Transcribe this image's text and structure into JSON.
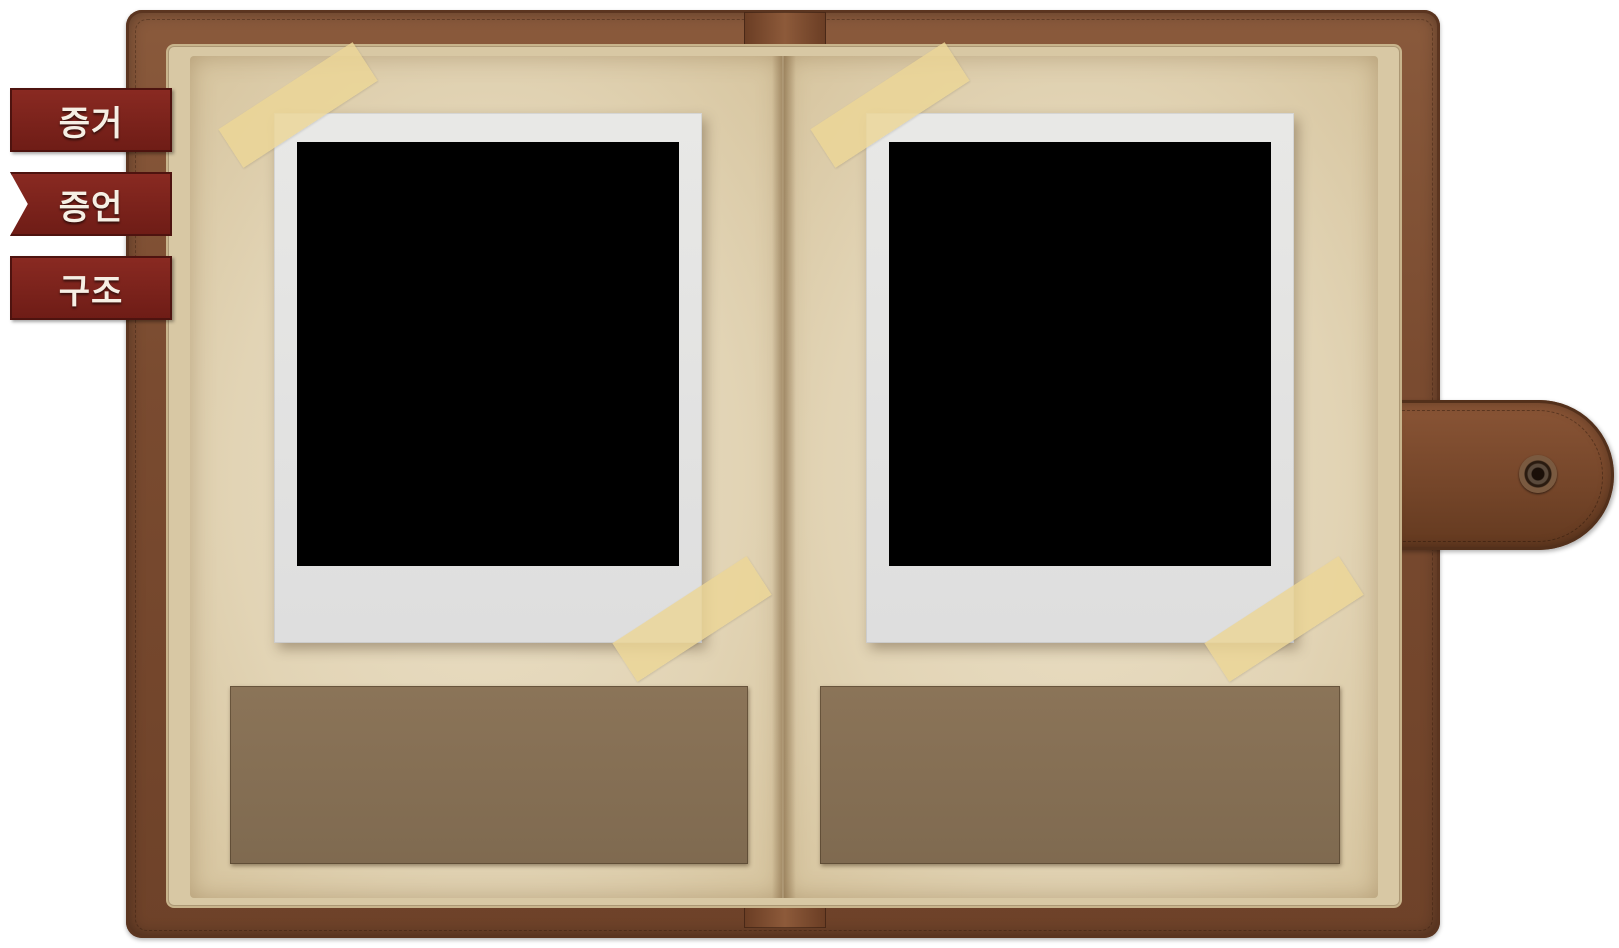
{
  "tabs": [
    {
      "id": "evidence",
      "label": "증거",
      "selected": false
    },
    {
      "id": "testimony",
      "label": "증언",
      "selected": true
    },
    {
      "id": "structure",
      "label": "구조",
      "selected": false
    }
  ],
  "pages": {
    "left": {
      "photo_caption": ""
    },
    "right": {
      "photo_caption": ""
    }
  },
  "colors": {
    "leather": "#7a4b30",
    "paper": "#e2d4b5",
    "tab": "#7a221b",
    "caption_card": "#84705a",
    "photo": "#000000",
    "polaroid_frame": "#e2e2e0",
    "tape": "#ecd696"
  }
}
